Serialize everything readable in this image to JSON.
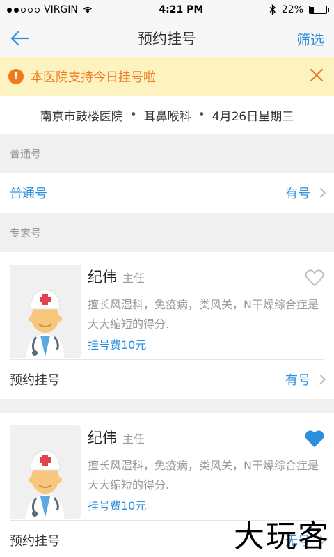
{
  "status_bar": {
    "carrier": "VIRGIN",
    "time": "4:21 PM",
    "battery": "22%",
    "battery_level": 0.22
  },
  "nav": {
    "title": "预约挂号",
    "filter_label": "筛选"
  },
  "notice": {
    "icon_text": "!",
    "text": "本医院支持今日挂号啦"
  },
  "hospital_info": {
    "hospital": "南京市鼓楼医院",
    "sep1": "•",
    "department": "耳鼻喉科",
    "sep2": "•",
    "date": "4月26日星期三"
  },
  "general_section": {
    "header": "普通号",
    "row_label": "普通号",
    "availability": "有号"
  },
  "expert_section": {
    "header": "专家号",
    "doctors": [
      {
        "name": "纪伟",
        "title": "主任",
        "desc": "擅长风湿科，免疫病，类风关，N干燥综合症是大大缩短的得分.",
        "fee": "挂号费10元",
        "favorited": false,
        "action_label": "预约挂号",
        "availability": "有号"
      },
      {
        "name": "纪伟",
        "title": "主任",
        "desc": "擅长风湿科，免疫病，类风关，N干燥综合症是大大缩短的得分.",
        "fee": "挂号费10元",
        "favorited": true,
        "action_label": "预约挂号",
        "availability": "无号"
      }
    ]
  },
  "watermark": "大玩客",
  "colors": {
    "accent": "#2b8fde",
    "notice_bg": "#fdf3c0",
    "notice_text": "#f07a22",
    "heart_filled": "#2b8fde"
  }
}
